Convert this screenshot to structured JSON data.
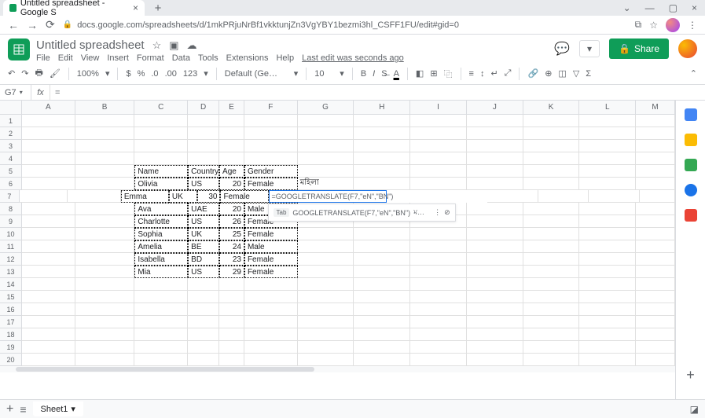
{
  "browser": {
    "tab_title": "Untitled spreadsheet - Google S",
    "url": "docs.google.com/spreadsheets/d/1mkPRjuNrBf1vkktunjZn3VgYBY1bezmi3hl_CSFF1FU/edit#gid=0"
  },
  "doc": {
    "title": "Untitled spreadsheet",
    "menus": [
      "File",
      "Edit",
      "View",
      "Insert",
      "Format",
      "Data",
      "Tools",
      "Extensions",
      "Help"
    ],
    "last_edit": "Last edit was seconds ago",
    "share": "Share"
  },
  "toolbar": {
    "zoom": "100%",
    "currency": "$",
    "percent": "%",
    "dec0": ".0",
    "dec00": ".00",
    "fmt123": "123",
    "font": "Default (Ge…",
    "size": "10"
  },
  "namebox": "G7",
  "fx": "=",
  "columns": [
    "A",
    "B",
    "C",
    "D",
    "E",
    "F",
    "G",
    "H",
    "I",
    "J",
    "K",
    "L",
    "M"
  ],
  "col_widths": [
    "cA",
    "cB",
    "cC",
    "cD",
    "cE",
    "cF",
    "cG",
    "cH",
    "cI",
    "cJ",
    "cK",
    "cL",
    "cM"
  ],
  "sheet": "Sheet1",
  "table": {
    "headers": {
      "c": "Name",
      "d": "Country",
      "e": "Age",
      "f": "Gender"
    },
    "rows": [
      {
        "c": "Olivia",
        "d": "US",
        "e": "20",
        "f": "Female"
      },
      {
        "c": "Emma",
        "d": "UK",
        "e": "30",
        "f": "Female"
      },
      {
        "c": "Ava",
        "d": "UAE",
        "e": "20",
        "f": "Male"
      },
      {
        "c": "Charlotte",
        "d": "US",
        "e": "26",
        "f": "Female"
      },
      {
        "c": "Sophia",
        "d": "UK",
        "e": "25",
        "f": "Female"
      },
      {
        "c": "Amelia",
        "d": "BE",
        "e": "24",
        "f": "Male"
      },
      {
        "c": "Isabella",
        "d": "BD",
        "e": "23",
        "f": "Female"
      },
      {
        "c": "Mia",
        "d": "US",
        "e": "29",
        "f": "Female"
      }
    ]
  },
  "g6": "মহিলা",
  "formula": {
    "entry": "=GOOGLETRANSLATE(F7,\"eN\",\"BN\")",
    "suggest_label": "Tab",
    "suggest_text": "GOOGLETRANSLATE(F7,\"eN\",\"BN\")",
    "suggest_trail": "ম…"
  }
}
